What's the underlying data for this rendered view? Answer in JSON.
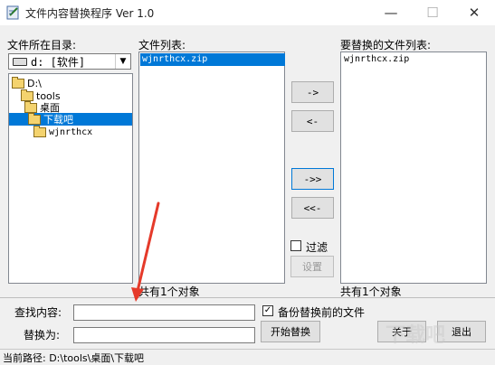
{
  "window": {
    "title": "文件内容替换程序 Ver 1.0",
    "minimize_glyph": "—",
    "maximize_glyph": "☐",
    "close_glyph": "✕"
  },
  "dir_panel": {
    "label": "文件所在目录:",
    "drive_value": "d: [软件]",
    "tree": [
      {
        "label": "D:\\",
        "selected": false
      },
      {
        "label": "tools",
        "selected": false
      },
      {
        "label": "桌面",
        "selected": false
      },
      {
        "label": "下载吧",
        "selected": true
      },
      {
        "label": "wjnrthcx",
        "selected": false
      }
    ]
  },
  "file_panel": {
    "label": "文件列表:",
    "files": [
      {
        "name": "wjnrthcx.zip",
        "selected": true
      }
    ],
    "count_text": "共有1个对象"
  },
  "replace_panel": {
    "label": "要替换的文件列表:",
    "files": [
      {
        "name": "wjnrthcx.zip"
      }
    ],
    "count_text": "共有1个对象"
  },
  "transfer_buttons": {
    "add": "->",
    "remove": "<-",
    "add_all": "->>",
    "remove_all": "<<-"
  },
  "filter": {
    "label": "过滤",
    "checked": false,
    "settings_label": "设置"
  },
  "search": {
    "find_label": "查找内容:",
    "find_value": "",
    "replace_label": "替换为:",
    "replace_value": ""
  },
  "backup": {
    "label": "备份替换前的文件",
    "checked": true
  },
  "actions": {
    "start": "开始替换",
    "about": "关于",
    "exit": "退出"
  },
  "status": {
    "current_path": "当前路径: D:\\tools\\桌面\\下载吧"
  },
  "watermark": {
    "text": "下载吧"
  },
  "colors": {
    "selection": "#0078d7",
    "annotation_arrow": "#e53a2a"
  }
}
